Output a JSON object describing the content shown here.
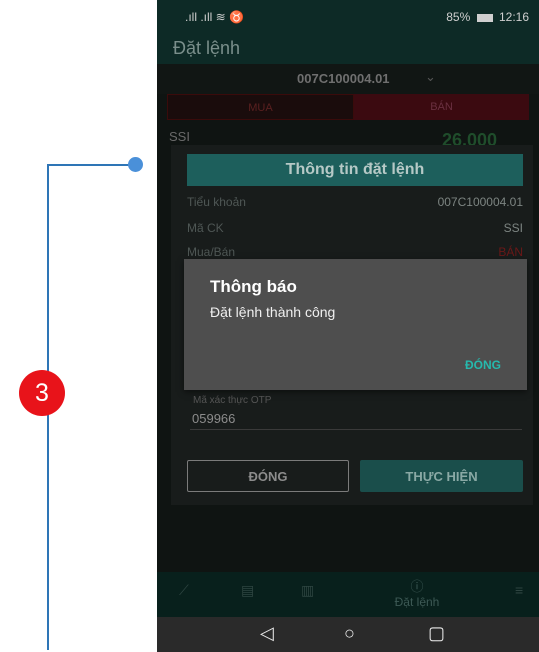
{
  "step_number": "3",
  "statusbar": {
    "signal": ".ıll .ıll ≋ ♉",
    "battery": "85%",
    "time": "12:16"
  },
  "app": {
    "title": "Đặt lệnh"
  },
  "account": {
    "number": "007C100004.01"
  },
  "tabs": {
    "buy": "MUA",
    "sell": "BÁN"
  },
  "stock": {
    "symbol": "SSI",
    "price": "26.000"
  },
  "dialog": {
    "title": "Thông tin đặt lệnh",
    "rows": [
      {
        "label": "Tiểu khoản",
        "value": "007C100004.01"
      },
      {
        "label": "Mã CK",
        "value": "SSI"
      },
      {
        "label": "Mua/Bán",
        "value": "BÁN"
      }
    ],
    "otp_label": "Mã xác thực OTP",
    "otp_value": "059966",
    "close_label": "ĐÓNG",
    "submit_label": "THỰC HIỆN"
  },
  "alert": {
    "title": "Thông báo",
    "message": "Đặt lệnh thành công",
    "ok_label": "ĐÓNG"
  },
  "bottom_nav": {
    "active_label": "Đặt lệnh"
  },
  "colors": {
    "accent": "#26b9ad",
    "sell": "#e8131a",
    "header": "#1d5f5c"
  }
}
